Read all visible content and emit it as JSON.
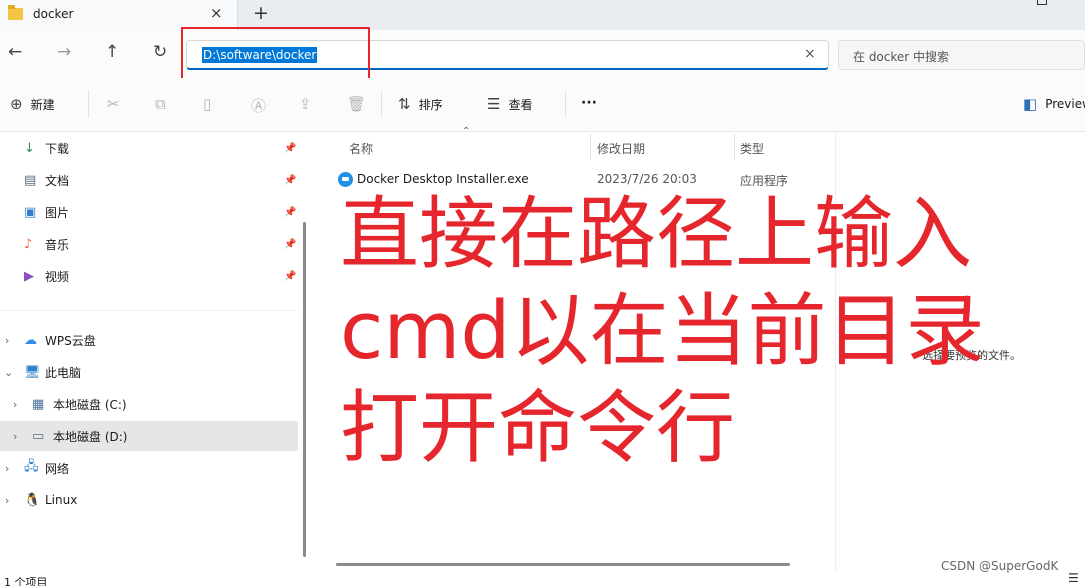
{
  "tab": {
    "title": "docker",
    "close": "×",
    "new_tab": "+"
  },
  "window": {
    "close": "×"
  },
  "nav": {
    "back": "←",
    "forward": "→",
    "up": "↑",
    "refresh": "↻"
  },
  "address": {
    "path": "D:\\software\\docker",
    "clear": "×"
  },
  "search": {
    "placeholder": "在 docker 中搜索"
  },
  "toolbar": {
    "new_label": "新建",
    "sort_label": "排序",
    "view_label": "查看",
    "more": "···",
    "preview_label": "Preview"
  },
  "sidebar": {
    "quick_access": [
      {
        "label": "下载",
        "icon": "download-icon",
        "glyph": "↓",
        "color": "#2e8b57"
      },
      {
        "label": "文档",
        "icon": "document-icon",
        "glyph": "▤",
        "color": "#5a6b7b"
      },
      {
        "label": "图片",
        "icon": "picture-icon",
        "glyph": "▣",
        "color": "#2f80c9"
      },
      {
        "label": "音乐",
        "icon": "music-icon",
        "glyph": "♪",
        "color": "#e2673e"
      },
      {
        "label": "视频",
        "icon": "video-icon",
        "glyph": "▶",
        "color": "#8a4fc2"
      }
    ],
    "tree": {
      "wps": "WPS云盘",
      "this_pc": "此电脑",
      "drive_c": "本地磁盘 (C:)",
      "drive_d": "本地磁盘 (D:)",
      "network": "网络",
      "linux": "Linux"
    }
  },
  "list": {
    "columns": {
      "name": "名称",
      "date": "修改日期",
      "type": "类型"
    },
    "files": [
      {
        "name": "Docker Desktop Installer.exe",
        "date": "2023/7/26 20:03",
        "type": "应用程序"
      }
    ]
  },
  "preview": {
    "message": "选择要预览的文件。"
  },
  "annotation": {
    "lines": [
      "直接在路径上输入",
      "cmd以在当前目录",
      "打开命令行"
    ],
    "color": "#e5262c"
  },
  "status": {
    "count": "1 个项目"
  },
  "watermark": "CSDN @SuperGodK",
  "colors": {
    "accent": "#0078d7",
    "selected_row": "#e6e6e6",
    "highlight_box": "#e5262c"
  }
}
